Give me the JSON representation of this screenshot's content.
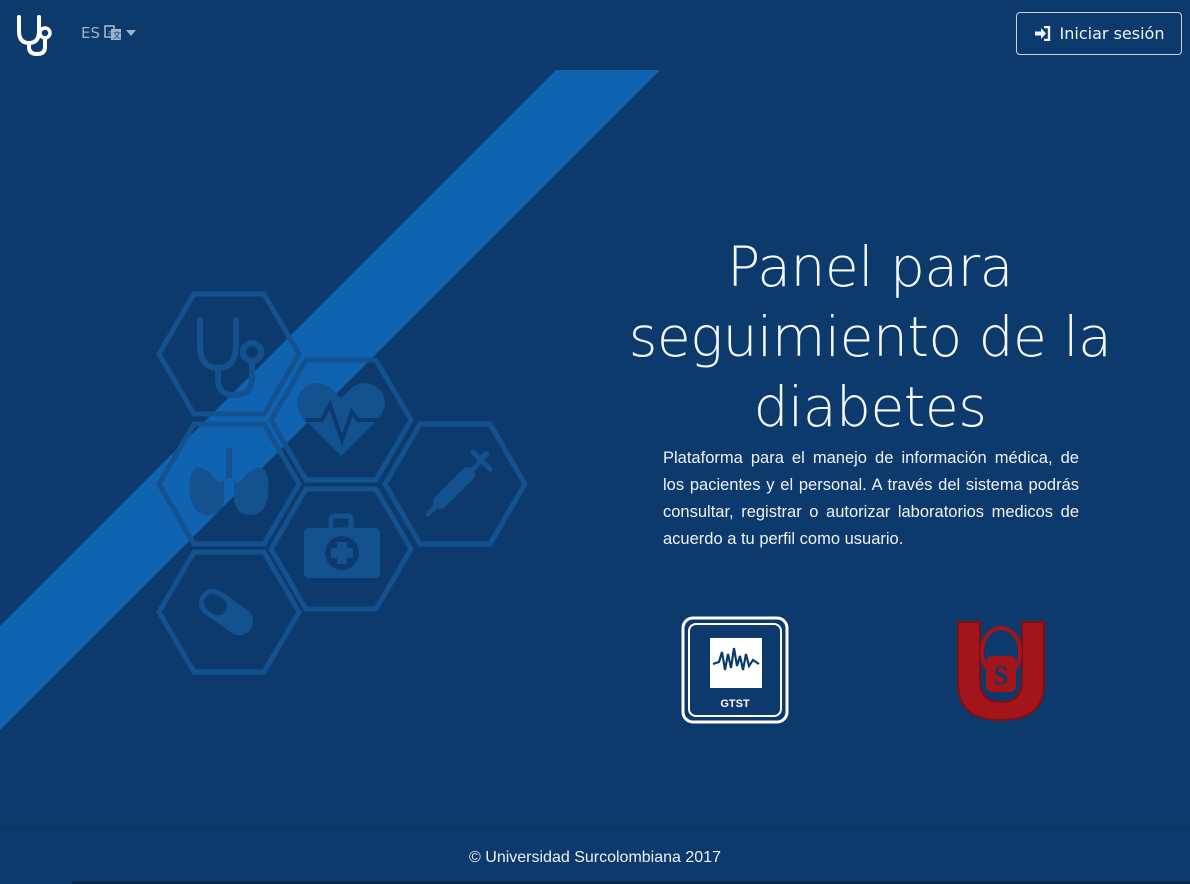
{
  "navbar": {
    "brand_icon": "stethoscope-icon",
    "language": {
      "code": "ES",
      "icon": "translate-icon",
      "caret_icon": "caret-down-icon"
    },
    "login": {
      "label": "Iniciar sesión",
      "icon": "sign-in-icon"
    }
  },
  "hero": {
    "title": "Panel para seguimiento de la diabetes",
    "description": "Plataforma para el manejo de información médica, de los pacientes y el personal. A través del sistema podrás consultar, registrar o autorizar laboratorios medicos de acuerdo a tu perfil como usuario.",
    "decorative_icons": [
      "stethoscope-icon",
      "heartbeat-icon",
      "lungs-icon",
      "syringe-icon",
      "first-aid-kit-icon",
      "pill-icon"
    ],
    "logos": [
      {
        "name": "gtst-logo",
        "text": "GTST"
      },
      {
        "name": "usco-logo",
        "text": "S"
      }
    ]
  },
  "footer": {
    "text": "© Universidad Surcolombiana 2017"
  },
  "colors": {
    "background": "#0c3a6c",
    "stripe": "#0f63b0",
    "hex_icon": "#14518f",
    "logo_red": "#a3141b"
  }
}
